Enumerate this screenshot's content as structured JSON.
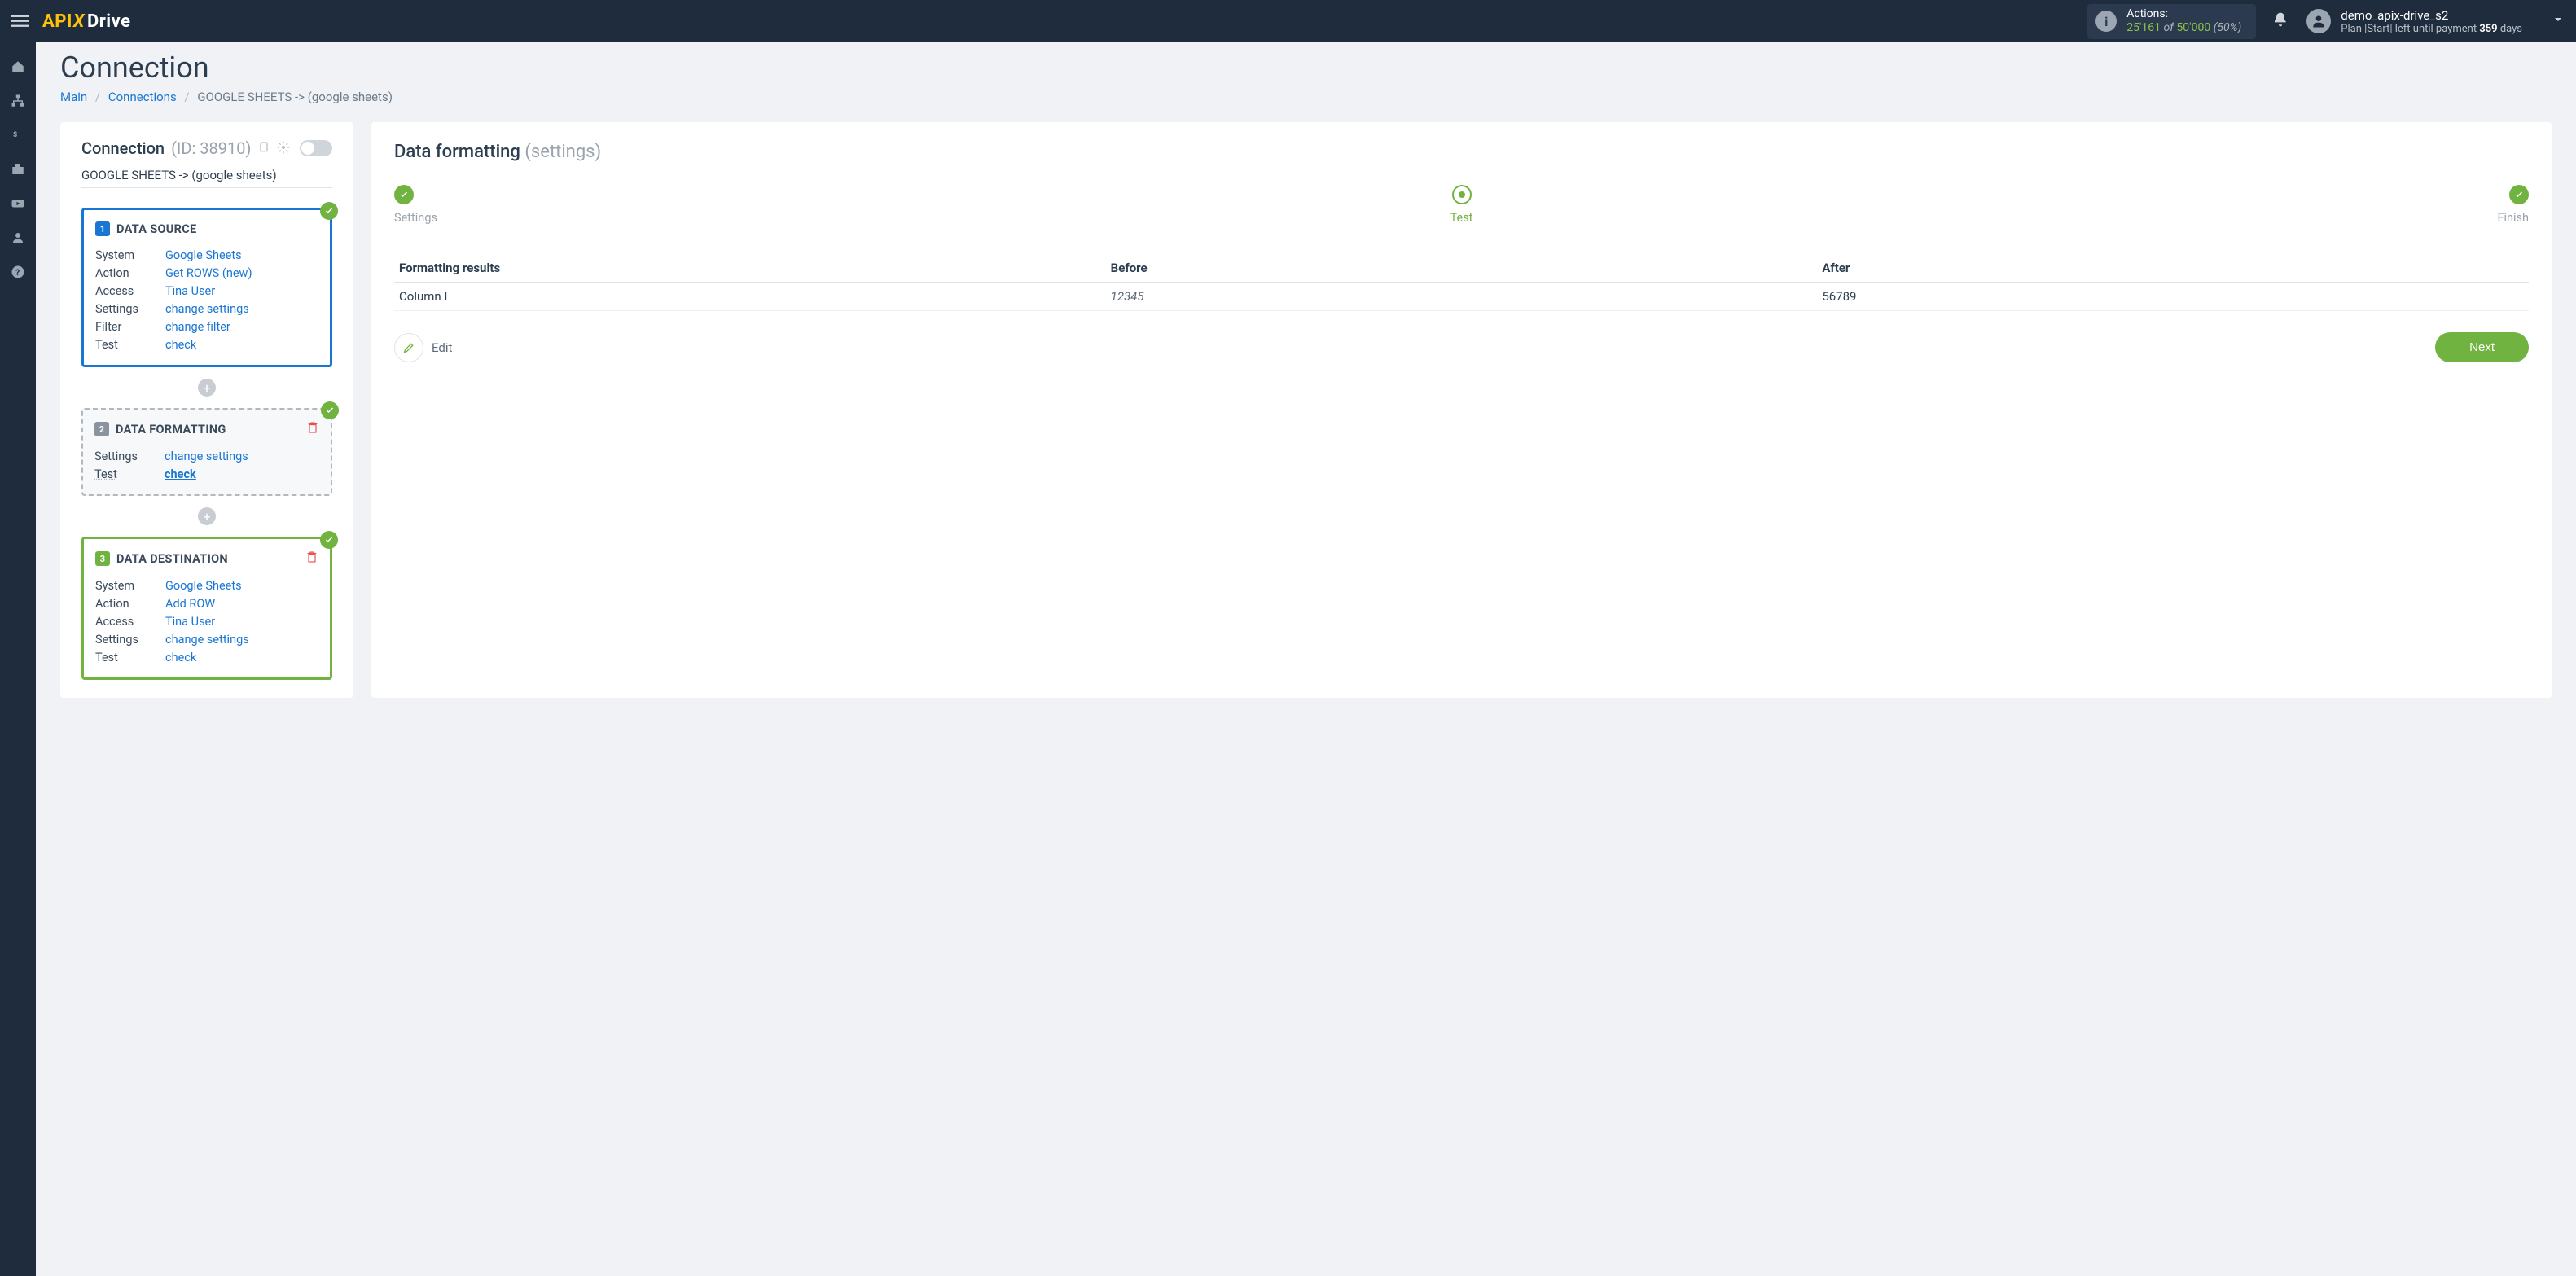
{
  "header": {
    "brand_api": "API",
    "brand_x": "X",
    "brand_drive": "Drive",
    "actions": {
      "label": "Actions:",
      "used": "25'161",
      "of": "of",
      "limit": "50'000",
      "pct": "(50%)"
    },
    "user": {
      "name": "demo_apix-drive_s2",
      "plan_prefix": "Plan |Start| left until payment ",
      "days": "359",
      "days_suffix": " days"
    }
  },
  "page": {
    "title": "Connection",
    "breadcrumb": {
      "main": "Main",
      "connections": "Connections",
      "current": "GOOGLE SHEETS -> (google sheets)"
    }
  },
  "left": {
    "title": "Connection",
    "id": "(ID: 38910)",
    "subtitle": "GOOGLE SHEETS -> (google sheets)",
    "card1": {
      "num": "1",
      "title": "DATA SOURCE",
      "rows": [
        {
          "k": "System",
          "v": "Google Sheets"
        },
        {
          "k": "Action",
          "v": "Get ROWS (new)"
        },
        {
          "k": "Access",
          "v": "Tina User"
        },
        {
          "k": "Settings",
          "v": "change settings"
        },
        {
          "k": "Filter",
          "v": "change filter"
        },
        {
          "k": "Test",
          "v": "check"
        }
      ]
    },
    "card2": {
      "num": "2",
      "title": "DATA FORMATTING",
      "rows": [
        {
          "k": "Settings",
          "v": "change settings"
        },
        {
          "k": "Test",
          "v": "check",
          "bold": true
        }
      ]
    },
    "card3": {
      "num": "3",
      "title": "DATA DESTINATION",
      "rows": [
        {
          "k": "System",
          "v": "Google Sheets"
        },
        {
          "k": "Action",
          "v": "Add ROW"
        },
        {
          "k": "Access",
          "v": "Tina User"
        },
        {
          "k": "Settings",
          "v": "change settings"
        },
        {
          "k": "Test",
          "v": "check"
        }
      ]
    }
  },
  "right": {
    "title": "Data formatting",
    "subtitle": "(settings)",
    "steps": {
      "s1": "Settings",
      "s2": "Test",
      "s3": "Finish"
    },
    "table": {
      "h1": "Formatting results",
      "h2": "Before",
      "h3": "After",
      "rows": [
        {
          "c1": "Column I",
          "c2": "12345",
          "c3": "56789"
        }
      ]
    },
    "edit": "Edit",
    "next": "Next"
  }
}
